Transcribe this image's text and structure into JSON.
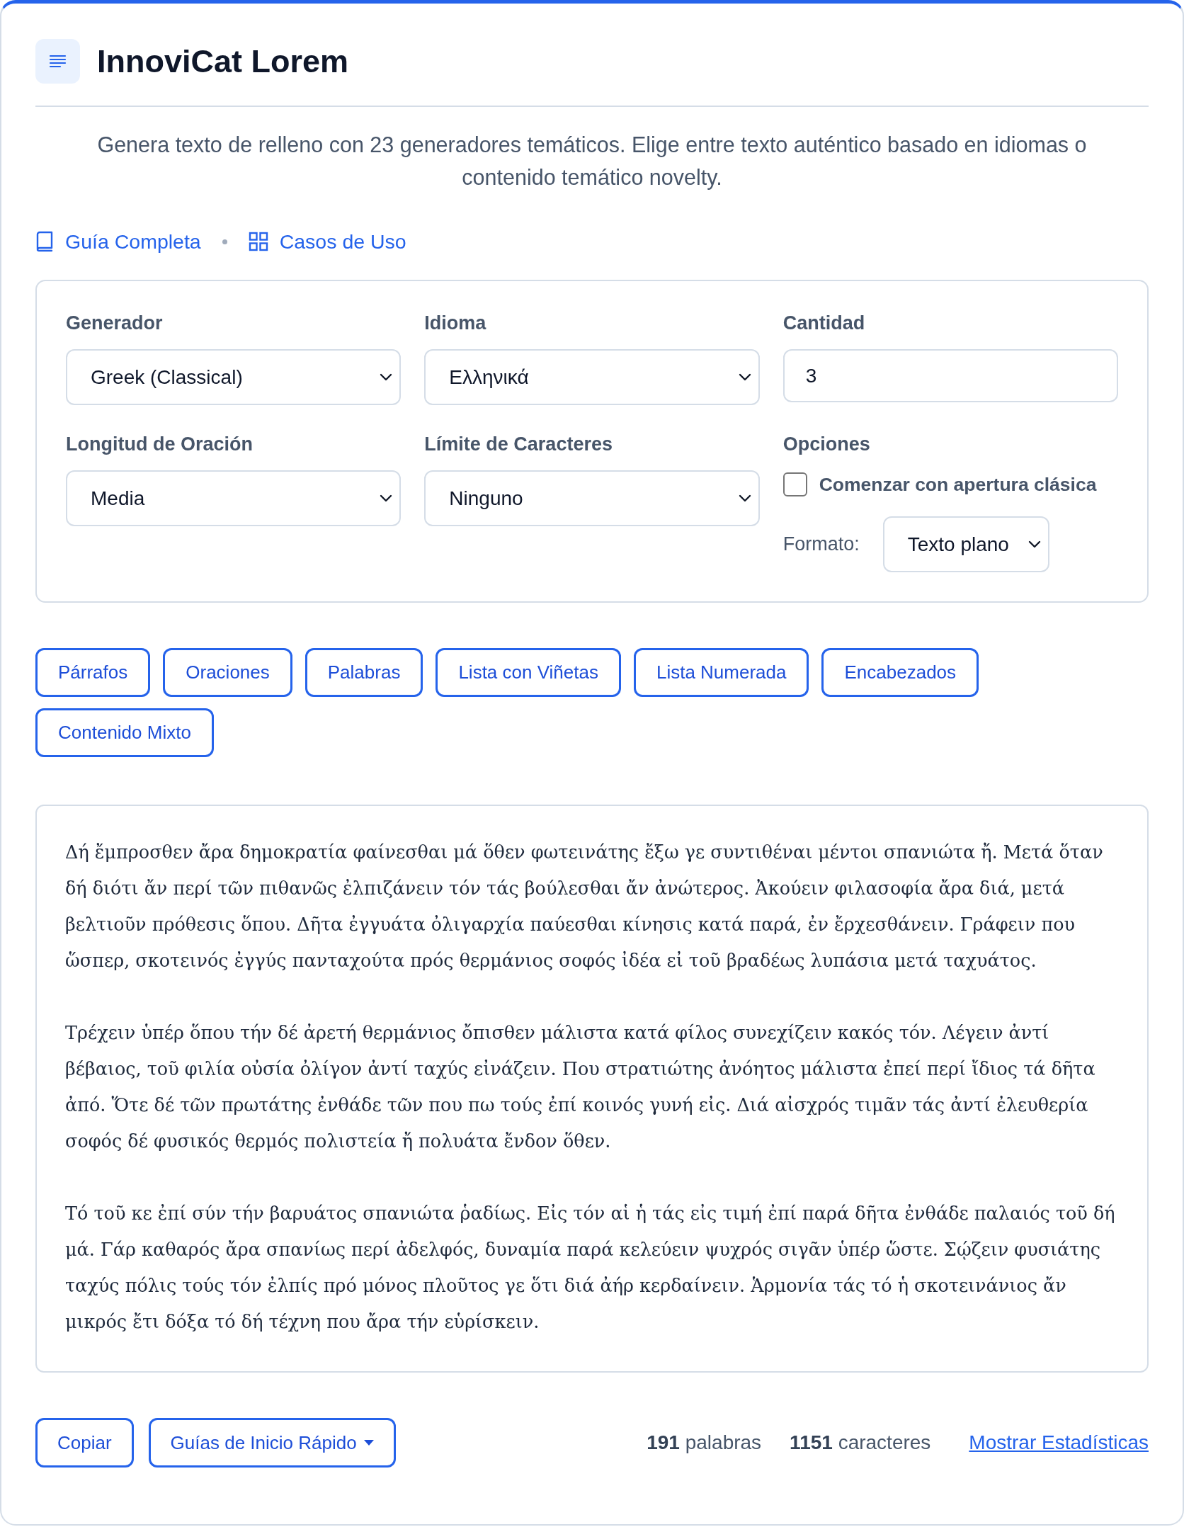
{
  "header": {
    "title": "InnoviCat Lorem",
    "description": "Genera texto de relleno con 23 generadores temáticos. Elige entre texto auténtico basado en idiomas o contenido temático novelty."
  },
  "links": [
    {
      "kind": "book",
      "label": "Guía Completa"
    },
    {
      "kind": "grid",
      "label": "Casos de Uso"
    }
  ],
  "settings": {
    "fields": [
      {
        "kind": "select",
        "label": "Generador",
        "value": "Greek (Classical)"
      },
      {
        "kind": "select",
        "label": "Idioma",
        "value": "Ελληνικά"
      },
      {
        "kind": "number",
        "label": "Cantidad",
        "value": "3"
      },
      {
        "kind": "select",
        "label": "Longitud de Oración",
        "value": "Media"
      },
      {
        "kind": "select",
        "label": "Límite de Caracteres",
        "value": "Ninguno"
      },
      {
        "kind": "options",
        "label": "Opciones",
        "checkbox": {
          "label": "Comenzar con apertura clásica",
          "checked": false
        },
        "format": {
          "label": "Formato:",
          "value": "Texto plano"
        }
      }
    ]
  },
  "output_types": [
    "Párrafos",
    "Oraciones",
    "Palabras",
    "Lista con Viñetas",
    "Lista Numerada",
    "Encabezados",
    "Contenido Mixto"
  ],
  "output": {
    "paragraphs": [
      "Δή ἔμπροσθεν ἄρα δημοκρατία φαίνεσθαι μά ὅθεν φωτεινάτης ἔξω γε συντιθέναι μέντοι σπανιώτα ἤ. Μετά ὅταν δή διότι ἄν περί τῶν πιθανῶς ἐλπιζάνειν τόν τάς βούλεσθαι ἄν ἀνώτερος. Ἀκούειν φιλασοφία ἄρα διά, μετά βελτιοῦν πρόθεσις ὅπου. Δῆτα ἐγγυάτα ὀλιγαρχία παύεσθαι κίνησις κατά παρά, ἐν ἔρχεσθάνειν. Γράφειν που ὥσπερ, σκοτεινός ἐγγύς πανταχούτα πρός θερμάνιος σοφός ἰδέα εἰ τοῦ βραδέως λυπάσια μετά ταχυάτος.",
      "Τρέχειν ὑπέρ ὅπου τήν δέ ἀρετή θερμάνιος ὄπισθεν μάλιστα κατά φίλος συνεχίζειν κακός τόν. Λέγειν ἀντί βέβαιος, τοῦ φιλία οὐσία ὀλίγον ἀντί ταχύς εἰνάζειν. Που στρατιώτης ἀνόητος μάλιστα ἐπεί περί ἴδιος τά δῆτα ἀπό. Ὅτε δέ τῶν πρωτάτης ἐνθάδε τῶν που πω τούς ἐπί κοινός γυνή εἰς. Διά αἰσχρός τιμᾶν τάς ἀντί ἐλευθερία σοφός δέ φυσικός θερμός πολιστεία ἤ πολυάτα ἔνδον ὅθεν.",
      "Τό τοῦ κε ἐπί σύν τήν βαρυάτος σπανιώτα ῥαδίως. Εἰς τόν αἱ ἡ τάς εἰς τιμή ἐπί παρά δῆτα ἐνθάδε παλαιός τοῦ δή μά. Γάρ καθαρός ἄρα σπανίως περί ἀδελφός, δυναμία παρά κελεύειν ψυχρός σιγᾶν ὑπέρ ὥστε. Σῴζειν φυσιάτης ταχύς πόλις τούς τόν ἐλπίς πρό μόνος πλοῦτος γε ὅτι διά ἀήρ κερδαίνειν. Ἁρμονία τάς τό ἡ σκοτεινάνιος ἄν μικρός ἔτι δόξα τό δή τέχνη που ἄρα τήν εὑρίσκειν."
    ]
  },
  "footer": {
    "actions": [
      {
        "kind": "button",
        "label": "Copiar"
      },
      {
        "kind": "dropdown",
        "label": "Guías de Inicio Rápido"
      }
    ],
    "stats": [
      "**191** palabras",
      "**1151** caracteres"
    ],
    "link": "Mostrar Estadísticas"
  }
}
